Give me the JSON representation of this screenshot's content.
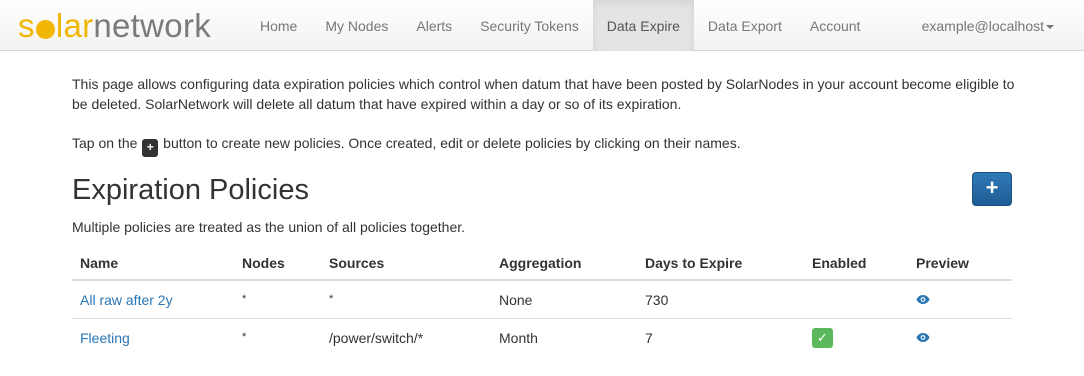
{
  "brand": {
    "part1": "s",
    "part2": "lar",
    "part3": "network"
  },
  "nav": {
    "items": [
      {
        "label": "Home"
      },
      {
        "label": "My Nodes"
      },
      {
        "label": "Alerts"
      },
      {
        "label": "Security Tokens"
      },
      {
        "label": "Data Expire"
      },
      {
        "label": "Data Export"
      },
      {
        "label": "Account"
      }
    ],
    "active": "Data Expire",
    "user": "example@localhost"
  },
  "intro": "This page allows configuring data expiration policies which control when datum that have been posted by SolarNodes in your account become eligible to be deleted. SolarNetwork will delete all datum that have expired within a day or so of its expiration.",
  "tap": {
    "before": "Tap on the",
    "button": "+",
    "after": "button to create new policies. Once created, edit or delete policies by clicking on their names."
  },
  "section": {
    "title": "Expiration Policies",
    "add_label": "+",
    "subtitle": "Multiple policies are treated as the union of all policies together."
  },
  "table": {
    "headers": {
      "name": "Name",
      "nodes": "Nodes",
      "sources": "Sources",
      "aggregation": "Aggregation",
      "days": "Days to Expire",
      "enabled": "Enabled",
      "preview": "Preview"
    },
    "rows": [
      {
        "name": "All raw after 2y",
        "nodes": "*",
        "sources": "*",
        "aggregation": "None",
        "days": "730",
        "enabled": false,
        "enabled_mark": ""
      },
      {
        "name": "Fleeting",
        "nodes": "*",
        "sources": "/power/switch/*",
        "aggregation": "Month",
        "days": "7",
        "enabled": true,
        "enabled_mark": "✓"
      }
    ]
  },
  "colors": {
    "brand_yellow": "#f2b705",
    "link": "#2a77b6",
    "primary_button": "#2a6eae",
    "enabled_green": "#5cb85c"
  },
  "icons": {
    "preview": "eye-icon",
    "enabled": "check-icon",
    "dropdown": "caret-down-icon"
  }
}
